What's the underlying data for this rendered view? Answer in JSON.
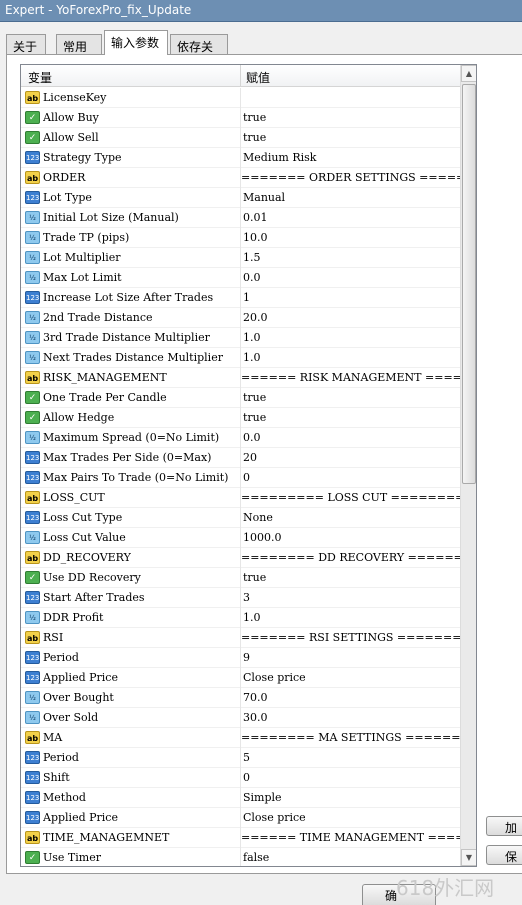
{
  "window": {
    "title": "Expert - YoForexPro_fix_Update"
  },
  "tabs": [
    {
      "label": "关于"
    },
    {
      "label": "常用"
    },
    {
      "label": "输入参数"
    },
    {
      "label": "依存关系"
    }
  ],
  "grid": {
    "columns": {
      "variable": "变量",
      "value": "赋值"
    },
    "rows": [
      {
        "icon": "ab",
        "name": "LicenseKey",
        "value": ""
      },
      {
        "icon": "bool",
        "name": "Allow Buy",
        "value": "true"
      },
      {
        "icon": "bool",
        "name": "Allow Sell",
        "value": "true"
      },
      {
        "icon": "num",
        "name": "Strategy Type",
        "value": "Medium Risk"
      },
      {
        "icon": "ab",
        "name": "ORDER",
        "value": "======= ORDER SETTINGS ======"
      },
      {
        "icon": "num",
        "name": "Lot Type",
        "value": "Manual"
      },
      {
        "icon": "dbl",
        "name": "Initial Lot Size (Manual)",
        "value": "0.01"
      },
      {
        "icon": "dbl",
        "name": "Trade TP (pips)",
        "value": "10.0"
      },
      {
        "icon": "dbl",
        "name": "Lot Multiplier",
        "value": "1.5"
      },
      {
        "icon": "dbl",
        "name": "Max Lot Limit",
        "value": "0.0"
      },
      {
        "icon": "num",
        "name": "Increase Lot Size After Trades",
        "value": "1"
      },
      {
        "icon": "dbl",
        "name": "2nd Trade Distance",
        "value": "20.0"
      },
      {
        "icon": "dbl",
        "name": "3rd Trade Distance Multiplier",
        "value": "1.0"
      },
      {
        "icon": "dbl",
        "name": "Next Trades Distance Multiplier",
        "value": "1.0"
      },
      {
        "icon": "ab",
        "name": "RISK_MANAGEMENT",
        "value": "====== RISK MANAGEMENT ====="
      },
      {
        "icon": "bool",
        "name": "One Trade Per Candle",
        "value": "true"
      },
      {
        "icon": "bool",
        "name": "Allow Hedge",
        "value": "true"
      },
      {
        "icon": "dbl",
        "name": "Maximum Spread (0=No Limit)",
        "value": "0.0"
      },
      {
        "icon": "num",
        "name": "Max Trades Per Side (0=Max)",
        "value": "20"
      },
      {
        "icon": "num",
        "name": "Max Pairs To Trade (0=No Limit)",
        "value": "0"
      },
      {
        "icon": "ab",
        "name": "LOSS_CUT",
        "value": "========= LOSS CUT ========="
      },
      {
        "icon": "num",
        "name": "Loss Cut Type",
        "value": "None"
      },
      {
        "icon": "dbl",
        "name": "Loss Cut Value",
        "value": "1000.0"
      },
      {
        "icon": "ab",
        "name": "DD_RECOVERY",
        "value": "======== DD RECOVERY ========"
      },
      {
        "icon": "bool",
        "name": "Use DD Recovery",
        "value": "true"
      },
      {
        "icon": "num",
        "name": "Start After Trades",
        "value": "3"
      },
      {
        "icon": "dbl",
        "name": "DDR Profit",
        "value": "1.0"
      },
      {
        "icon": "ab",
        "name": "RSI",
        "value": "======= RSI SETTINGS ========"
      },
      {
        "icon": "num",
        "name": "Period",
        "value": "9"
      },
      {
        "icon": "num",
        "name": "Applied Price",
        "value": "Close price"
      },
      {
        "icon": "dbl",
        "name": "Over Bought",
        "value": "70.0"
      },
      {
        "icon": "dbl",
        "name": "Over Sold",
        "value": "30.0"
      },
      {
        "icon": "ab",
        "name": "MA",
        "value": "======== MA SETTINGS ========"
      },
      {
        "icon": "num",
        "name": "Period",
        "value": "5"
      },
      {
        "icon": "num",
        "name": "Shift",
        "value": "0"
      },
      {
        "icon": "num",
        "name": "Method",
        "value": "Simple"
      },
      {
        "icon": "num",
        "name": "Applied Price",
        "value": "Close price"
      },
      {
        "icon": "ab",
        "name": "TIME_MANAGEMNET",
        "value": "====== TIME MANAGEMENT ======"
      },
      {
        "icon": "bool",
        "name": "Use Timer",
        "value": "false"
      }
    ]
  },
  "side_buttons": {
    "load": "加",
    "save": "保"
  },
  "ok_button": "确",
  "watermark": "618外汇网",
  "icon_glyphs": {
    "ab": "ab",
    "bool": "✓",
    "num": "123",
    "dbl": "½"
  }
}
